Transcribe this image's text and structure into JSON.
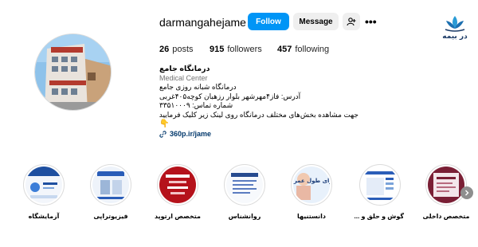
{
  "watermark": {
    "text": "در بیمه"
  },
  "profile": {
    "username": "darmangahejame",
    "follow_label": "Follow",
    "message_label": "Message",
    "more_label": "•••"
  },
  "stats": {
    "posts_count": "26",
    "posts_label": "posts",
    "followers_count": "915",
    "followers_label": "followers",
    "following_count": "457",
    "following_label": "following"
  },
  "bio": {
    "name": "درمانگاه جامع",
    "category": "Medical Center",
    "lines": [
      "درمانگاه شبانه روزی جامع",
      "آدرس: فاز۴مهرشهر بلوار رزهبان کوچه۴۰۵غربی",
      "شماره تماس: ۳۳۵۱۰۰۰۹",
      "جهت مشاهده بخش‌های مختلف درمانگاه روی لینک زیر کلیک فرمایید"
    ],
    "emoji": "👇",
    "link": "360p.ir/jame"
  },
  "highlights": [
    {
      "label": "آزمایشگاه"
    },
    {
      "label": "فیزیوتراپی"
    },
    {
      "label": "متخصص ارتوپد"
    },
    {
      "label": "روانشناس"
    },
    {
      "label": "دانستنیها"
    },
    {
      "label": "گوش و حلق و ..."
    },
    {
      "label": "متخصص داخلی"
    }
  ],
  "highlight_texts": {
    "story5": "۶ نسخه برای طول عمر"
  }
}
